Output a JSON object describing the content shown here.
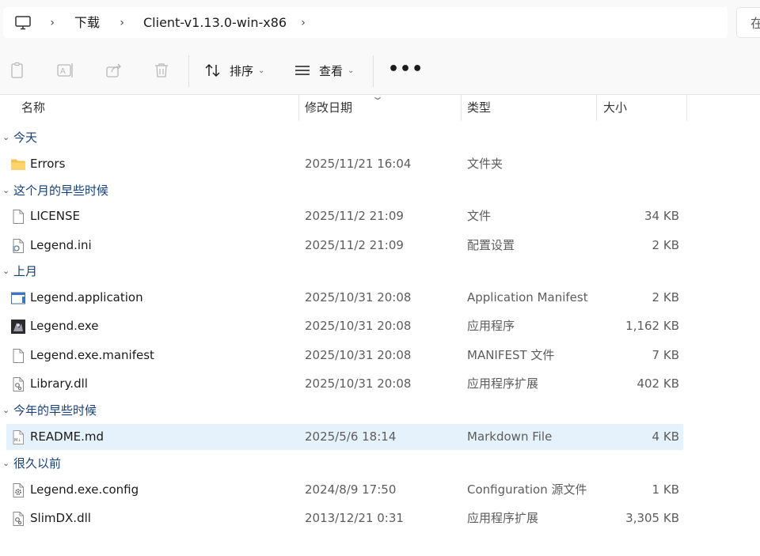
{
  "address": {
    "breadcrumbs": [
      "下载",
      "Client-v1.13.0-win-x86"
    ],
    "search_placeholder": "在"
  },
  "toolbar": {
    "sort_label": "排序",
    "view_label": "查看",
    "more_label": "•••"
  },
  "columns": {
    "name": "名称",
    "date": "修改日期",
    "type": "类型",
    "size": "大小"
  },
  "groups": {
    "today": "今天",
    "earlier_this_month": "这个月的早些时候",
    "last_month": "上月",
    "earlier_this_year": "今年的早些时候",
    "long_ago": "很久以前"
  },
  "files": [
    {
      "name": "Errors",
      "date": "2025/11/21 16:04",
      "type": "文件夹",
      "size": "",
      "icon": "folder-icon"
    },
    {
      "name": "LICENSE",
      "date": "2025/11/2 21:09",
      "type": "文件",
      "size": "34 KB",
      "icon": "file-icon"
    },
    {
      "name": "Legend.ini",
      "date": "2025/11/2 21:09",
      "type": "配置设置",
      "size": "2 KB",
      "icon": "ini-file-icon"
    },
    {
      "name": "Legend.application",
      "date": "2025/10/31 20:08",
      "type": "Application Manifest",
      "size": "2 KB",
      "icon": "application-manifest-icon"
    },
    {
      "name": "Legend.exe",
      "date": "2025/10/31 20:08",
      "type": "应用程序",
      "size": "1,162 KB",
      "icon": "exe-app-icon"
    },
    {
      "name": "Legend.exe.manifest",
      "date": "2025/10/31 20:08",
      "type": "MANIFEST 文件",
      "size": "7 KB",
      "icon": "file-icon"
    },
    {
      "name": "Library.dll",
      "date": "2025/10/31 20:08",
      "type": "应用程序扩展",
      "size": "402 KB",
      "icon": "dll-file-icon"
    },
    {
      "name": "README.md",
      "date": "2025/5/6 18:14",
      "type": "Markdown File",
      "size": "4 KB",
      "icon": "markdown-file-icon"
    },
    {
      "name": "Legend.exe.config",
      "date": "2024/8/9 17:50",
      "type": "Configuration 源文件",
      "size": "1 KB",
      "icon": "config-file-icon"
    },
    {
      "name": "SlimDX.dll",
      "date": "2013/12/21 0:31",
      "type": "应用程序扩展",
      "size": "3,305 KB",
      "icon": "dll-file-icon"
    }
  ],
  "colors": {
    "accent_group_text": "#16407a",
    "selection": "#e5f1fb",
    "folder": "#f4c04f"
  }
}
